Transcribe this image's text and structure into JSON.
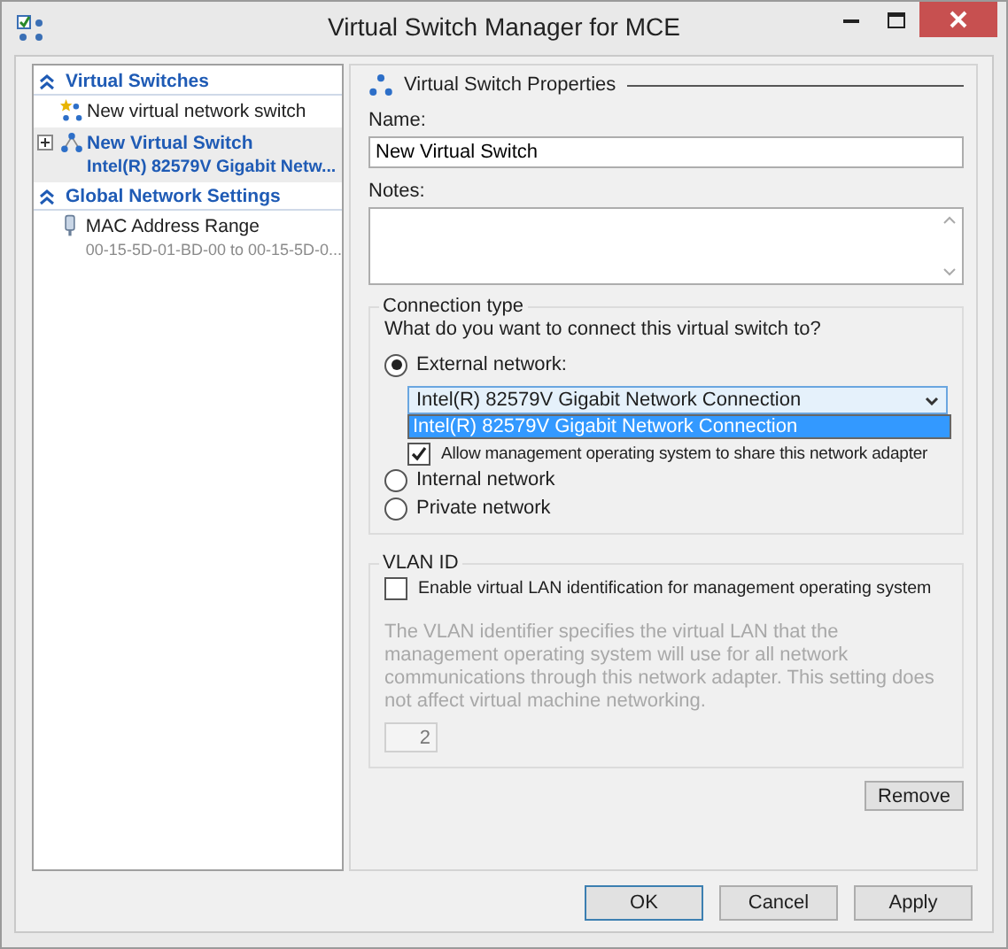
{
  "window": {
    "title": "Virtual Switch Manager for MCE"
  },
  "sidebar": {
    "sections": [
      {
        "title": "Virtual Switches",
        "expanded": true,
        "items": [
          {
            "kind": "new",
            "label": "New virtual network switch",
            "selected": false
          },
          {
            "kind": "switch",
            "label": "New Virtual Switch",
            "detail": "Intel(R) 82579V Gigabit Netw...",
            "selected": true,
            "expanded": false
          }
        ]
      },
      {
        "title": "Global Network Settings",
        "expanded": true,
        "items": [
          {
            "kind": "mac",
            "label": "MAC Address Range",
            "detail": "00-15-5D-01-BD-00 to 00-15-5D-0...",
            "selected": false
          }
        ]
      }
    ]
  },
  "properties": {
    "heading": "Virtual Switch Properties",
    "name_label": "Name:",
    "name_value": "New Virtual Switch",
    "notes_label": "Notes:",
    "connection_type": {
      "title": "Connection type",
      "question": "What do you want to connect this virtual switch to?",
      "options": [
        {
          "label": "External network:",
          "selected": true
        },
        {
          "label": "Internal network",
          "selected": false
        },
        {
          "label": "Private network",
          "selected": false
        }
      ],
      "adapter_dropdown": {
        "value": "Intel(R) 82579V Gigabit Network Connection",
        "open": true,
        "options": [
          {
            "label": "Intel(R) 82579V Gigabit Network Connection",
            "selected": true
          }
        ]
      },
      "share_checkbox": {
        "label": "Allow management operating system to share this network adapter",
        "checked": true
      }
    },
    "vlan": {
      "title": "VLAN ID",
      "checkbox": {
        "label": "Enable virtual LAN identification for management operating system",
        "checked": false
      },
      "description": "The VLAN identifier specifies the virtual LAN that the management operating system will use for all network communications through this network adapter. This setting does not affect virtual machine networking.",
      "vlan_id": "2",
      "disabled": true
    },
    "remove_button": "Remove"
  },
  "buttons": [
    {
      "label": "OK",
      "default": true
    },
    {
      "label": "Cancel",
      "default": false
    },
    {
      "label": "Apply",
      "default": false
    }
  ]
}
